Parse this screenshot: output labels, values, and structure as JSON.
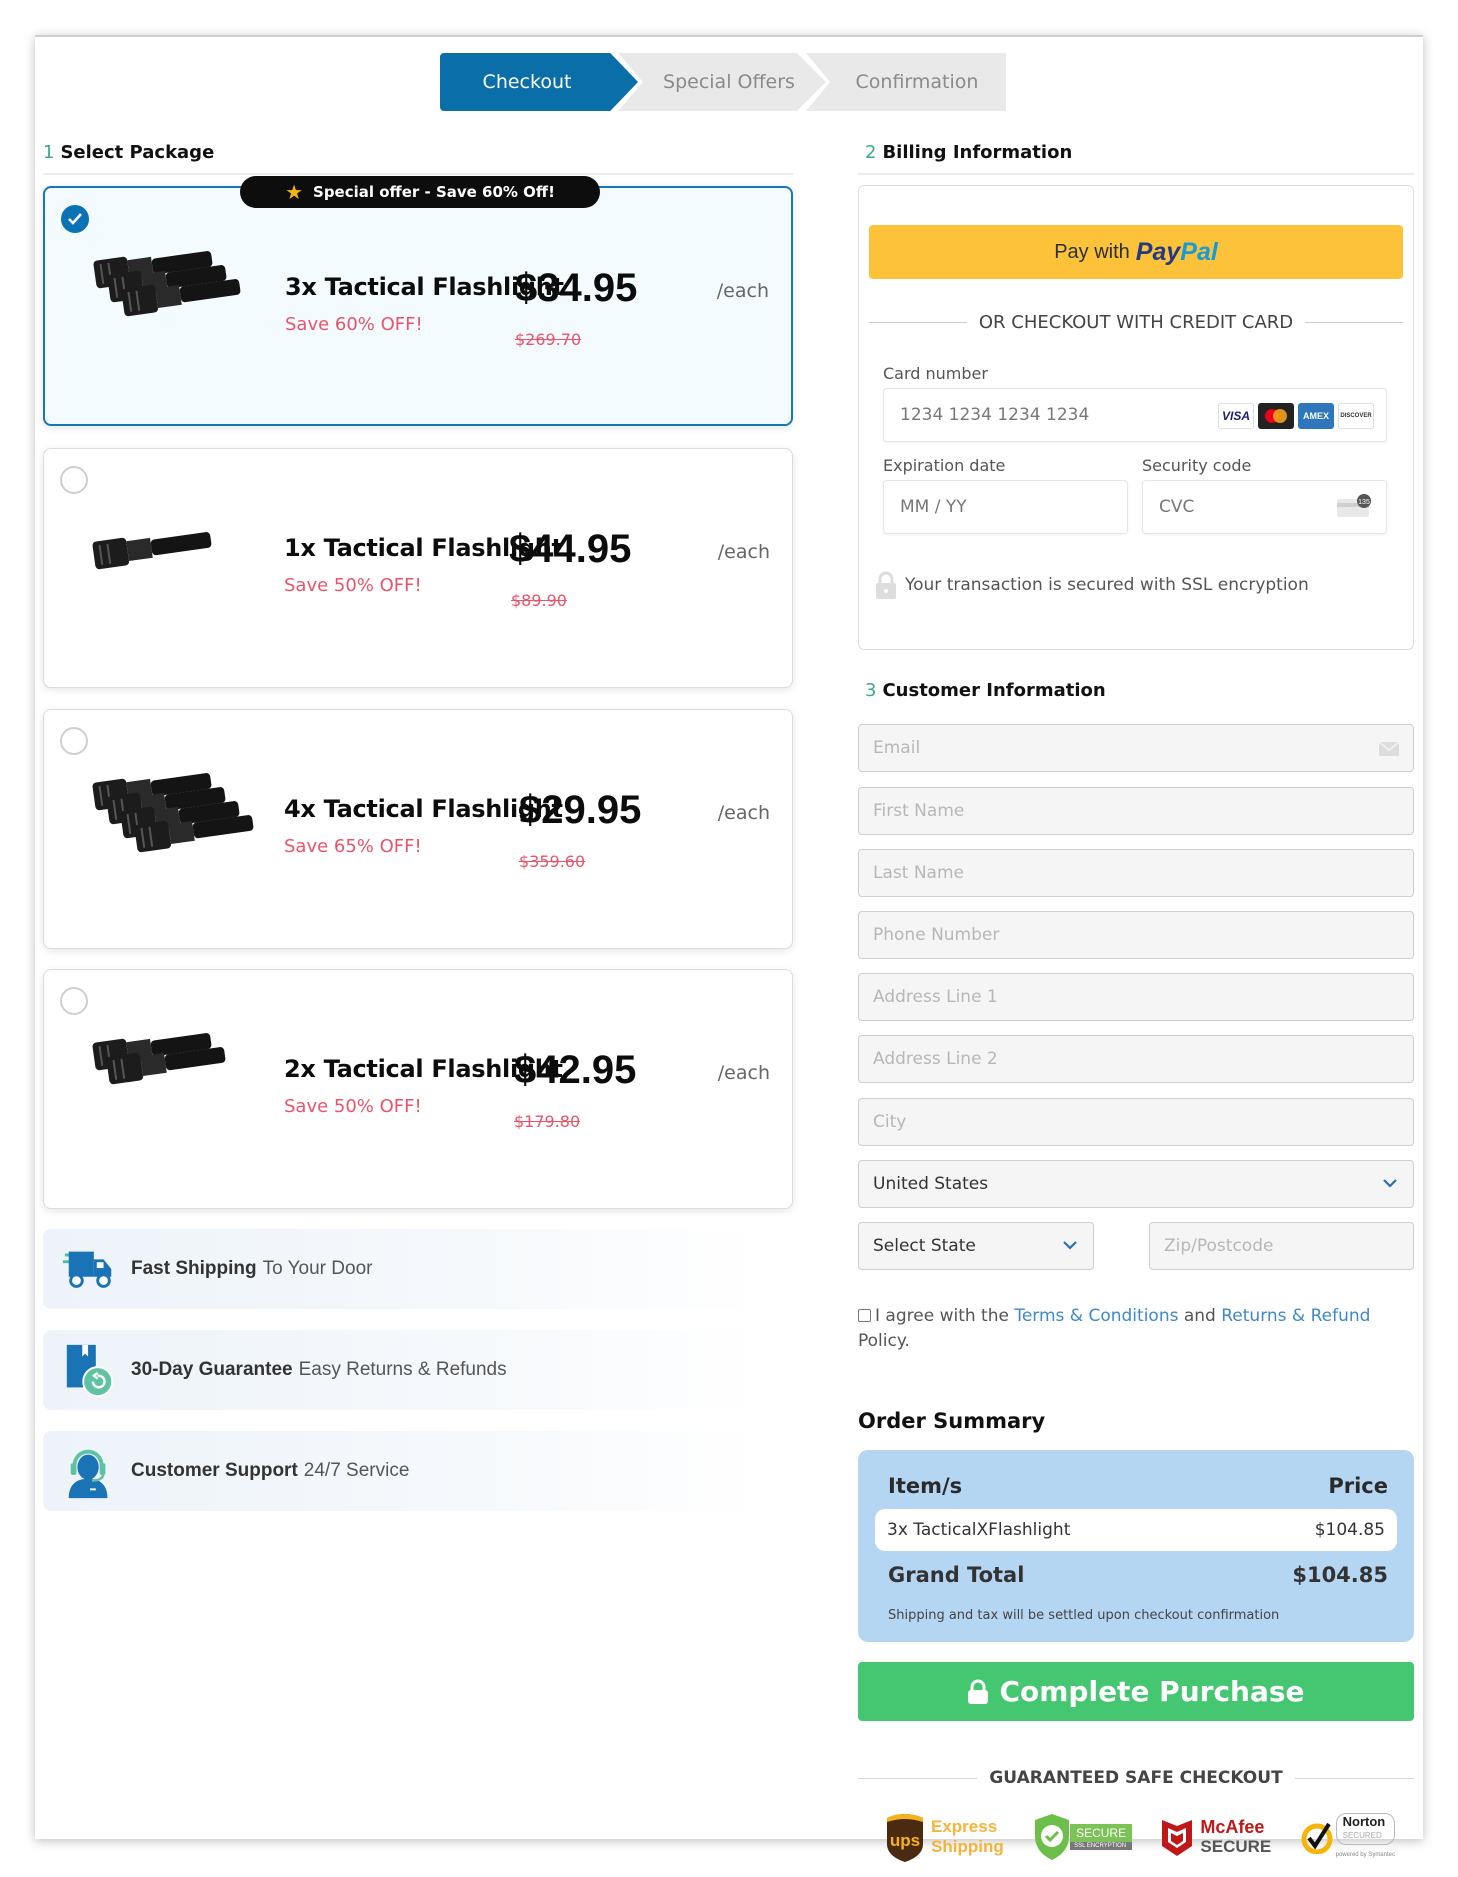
{
  "steps": [
    {
      "label": "Checkout",
      "active": true
    },
    {
      "label": "Special Offers",
      "active": false
    },
    {
      "label": "Confirmation",
      "active": false
    }
  ],
  "sections": {
    "package": {
      "num": "1",
      "title": "Select Package"
    },
    "billing": {
      "num": "2",
      "title": "Billing Information"
    },
    "customer": {
      "num": "3",
      "title": "Customer Information"
    }
  },
  "packages": [
    {
      "name": "3x Tactical Flashlight",
      "save": "Save 60% OFF!",
      "price": "$34.95",
      "per": "/each",
      "old_price": "$269.70",
      "selected": true,
      "ribbon": "Special offer - Save 60% Off!",
      "count": 3
    },
    {
      "name": "1x Tactical Flashlight",
      "save": "Save 50% OFF!",
      "price": "$44.95",
      "per": "/each",
      "old_price": "$89.90",
      "selected": false,
      "count": 1
    },
    {
      "name": "4x Tactical Flashlight",
      "save": "Save 65% OFF!",
      "price": "$29.95",
      "per": "/each",
      "old_price": "$359.60",
      "selected": false,
      "count": 4
    },
    {
      "name": "2x Tactical Flashlight",
      "save": "Save 50% OFF!",
      "price": "$42.95",
      "per": "/each",
      "old_price": "$179.80",
      "selected": false,
      "count": 2
    }
  ],
  "features": [
    {
      "icon": "truck-icon",
      "bold": "Fast Shipping",
      "text": "To Your Door"
    },
    {
      "icon": "return-box-icon",
      "bold": "30-Day Guarantee",
      "text": "Easy Returns & Refunds"
    },
    {
      "icon": "support-agent-icon",
      "bold": "Customer Support",
      "text": "24/7 Service"
    }
  ],
  "billing": {
    "paypal_prefix": "Pay with",
    "paypal_brand_1": "Pay",
    "paypal_brand_2": "Pal",
    "or_text": "OR CHECKOUT WITH CREDIT CARD",
    "card_number_label": "Card number",
    "card_number_placeholder": "1234 1234 1234 1234",
    "card_brands": [
      "VISA",
      "Mastercard",
      "AMEX",
      "DISCOVER"
    ],
    "expiry_label": "Expiration date",
    "expiry_placeholder": "MM / YY",
    "cvc_label": "Security code",
    "cvc_placeholder": "CVC",
    "cvc_icon_text": "135",
    "ssl_text": "Your transaction is secured with SSL encryption"
  },
  "customer": {
    "email": "Email",
    "first_name": "First Name",
    "last_name": "Last Name",
    "phone": "Phone Number",
    "address1": "Address Line 1",
    "address2": "Address Line 2",
    "city": "City",
    "country": "United States",
    "state": "Select State",
    "zip": "Zip/Postcode"
  },
  "agreement": {
    "prefix": "I agree with the",
    "terms": "Terms & Conditions",
    "and": "and",
    "returns": "Returns & Refund",
    "suffix": "Policy."
  },
  "order_summary": {
    "title": "Order Summary",
    "col_item": "Item/s",
    "col_price": "Price",
    "items": [
      {
        "name": "3x TacticalXFlashlight",
        "price": "$104.85"
      }
    ],
    "grand_total_label": "Grand Total",
    "grand_total": "$104.85",
    "note": "Shipping and tax will be settled upon checkout confirmation"
  },
  "purchase_button": "Complete Purchase",
  "guarantee_title": "GUARANTEED SAFE CHECKOUT",
  "trust_badges": {
    "ups": {
      "logo": "ups",
      "line1": "Express",
      "line2": "Shipping"
    },
    "ssl": {
      "line1": "SECURE",
      "line2": "SSL ENCRYPTION"
    },
    "mcafee": {
      "line1": "McAfee",
      "line2": "SECURE"
    },
    "norton": {
      "line1": "Norton",
      "line2": "SECURED",
      "line3": "powered by Symantec"
    }
  },
  "colors": {
    "brand_blue": "#0a6fa8",
    "accent_green": "#45c772",
    "save_red": "#e8556b",
    "paypal_yellow": "#fcc33a",
    "summary_blue": "#b5d6f2"
  }
}
